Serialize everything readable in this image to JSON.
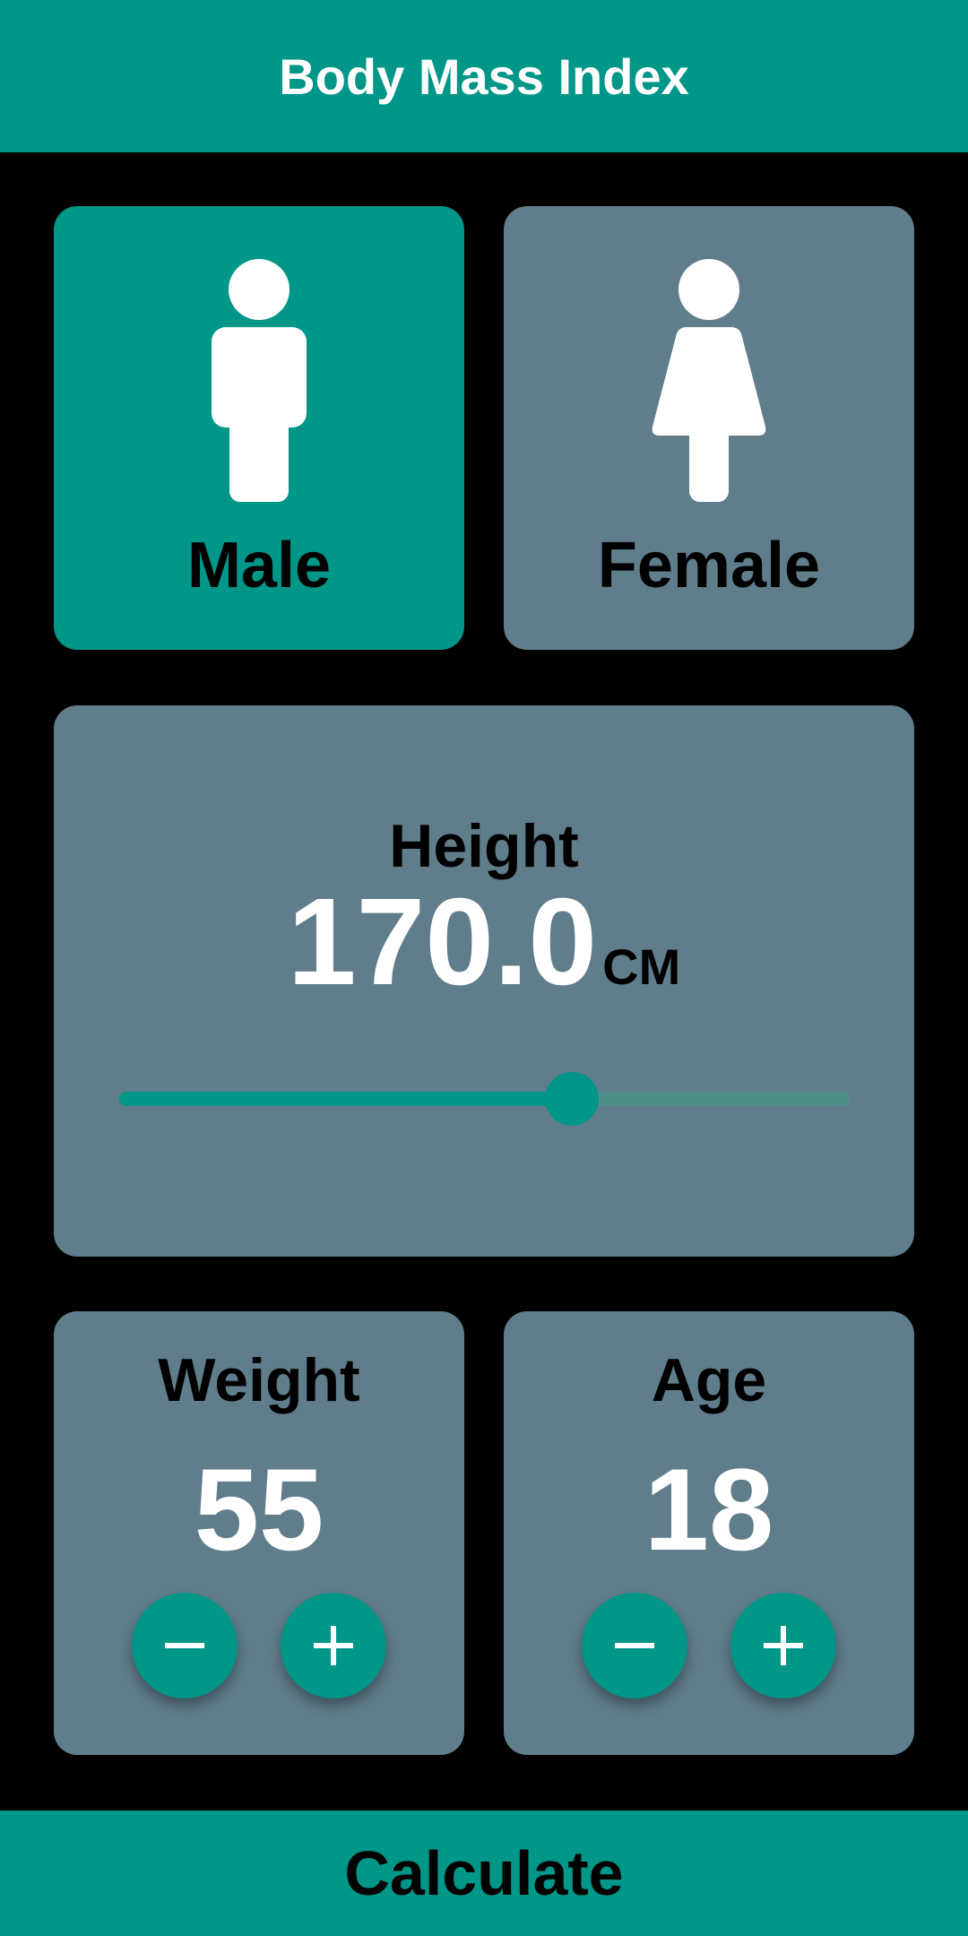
{
  "app_bar": {
    "title": "Body Mass Index"
  },
  "gender": {
    "male_label": "Male",
    "female_label": "Female",
    "selected": "male"
  },
  "height": {
    "label": "Height",
    "value": "170.0",
    "unit": "CM",
    "slider_fraction": 0.62
  },
  "weight": {
    "label": "Weight",
    "value": "55"
  },
  "age": {
    "label": "Age",
    "value": "18"
  },
  "calculate": {
    "label": "Calculate"
  },
  "colors": {
    "accent": "#009688",
    "card": "#607d8b",
    "background": "#000000",
    "inactive_track": "#4f8f8a"
  },
  "icons": {
    "male": "male-figure-icon",
    "female": "female-figure-icon",
    "minus": "minus-icon",
    "plus": "plus-icon"
  }
}
